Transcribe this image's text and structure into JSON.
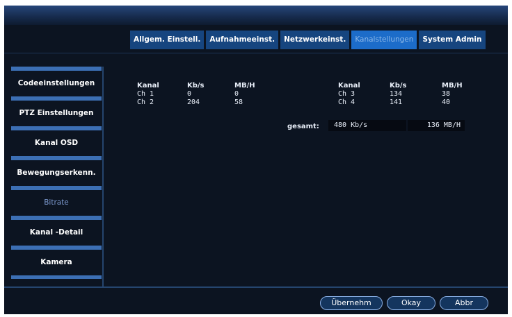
{
  "tabs": [
    {
      "label": "Allgem. Einstell."
    },
    {
      "label": "Aufnahmeeinst."
    },
    {
      "label": "Netzwerkeinst."
    },
    {
      "label": "Kanalstellungen"
    },
    {
      "label": "System Admin"
    }
  ],
  "sidebar": {
    "items": [
      {
        "label": "Codeeinstellungen"
      },
      {
        "label": "PTZ Einstellungen"
      },
      {
        "label": "Kanal OSD"
      },
      {
        "label": "Bewegungserkenn."
      },
      {
        "label": "Bitrate"
      },
      {
        "label": "Kanal -Detail"
      },
      {
        "label": "Kamera"
      }
    ],
    "active_index": 4
  },
  "table": {
    "headers": [
      "Kanal",
      "Kb/s",
      "MB/H"
    ],
    "left": [
      {
        "kanal": "Ch 1",
        "kbs": "0",
        "mbh": "0"
      },
      {
        "kanal": "Ch 2",
        "kbs": "204",
        "mbh": "58"
      }
    ],
    "right": [
      {
        "kanal": "Ch 3",
        "kbs": "134",
        "mbh": "38"
      },
      {
        "kanal": "Ch 4",
        "kbs": "141",
        "mbh": "40"
      }
    ]
  },
  "total": {
    "label": "gesamt:",
    "kbs": "480 Kb/s",
    "mbh": "136 MB/H"
  },
  "buttons": {
    "apply": "Übernehm",
    "okay": "Okay",
    "cancel": "Abbr"
  },
  "colors": {
    "background": "#0c1421",
    "tab": "#16457f",
    "tab_active": "#1c6cc9",
    "sidebar_accent": "#3c6fb4"
  }
}
